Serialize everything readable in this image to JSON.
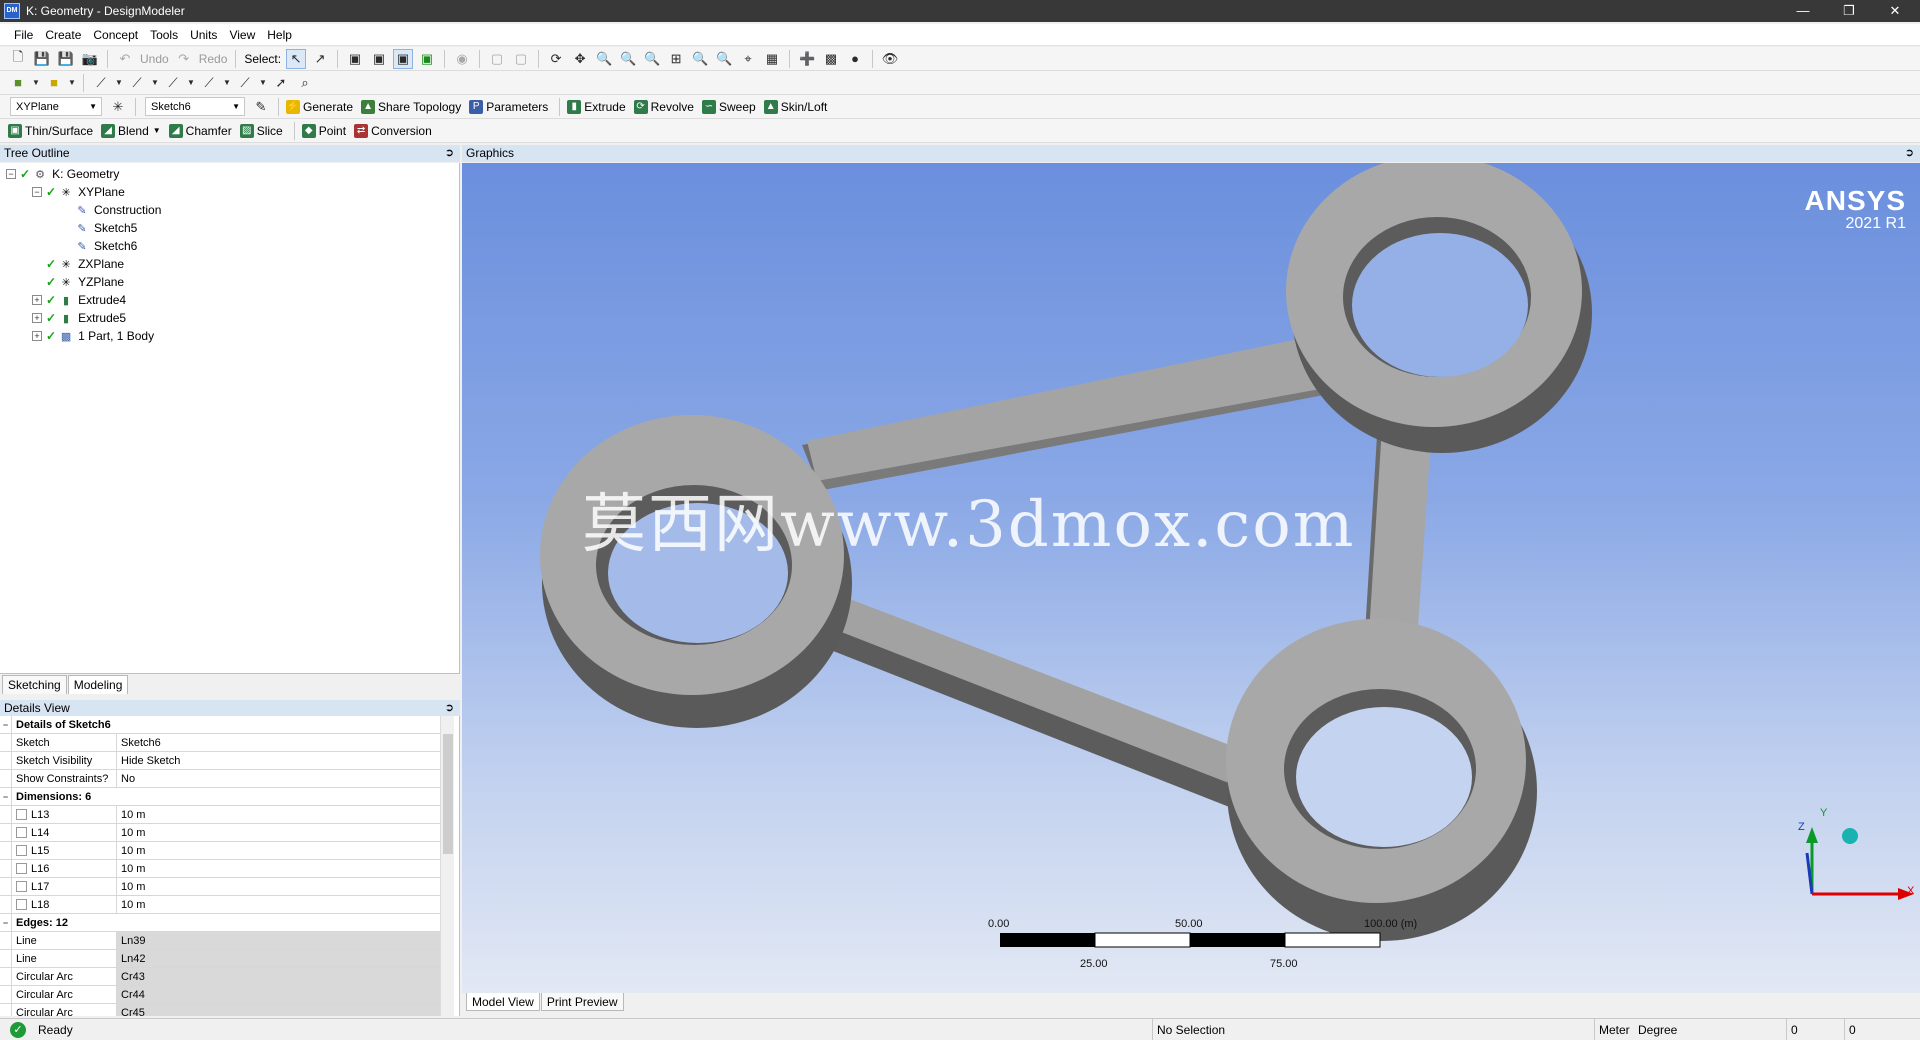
{
  "window": {
    "title": "K: Geometry - DesignModeler",
    "app_icon": "DM"
  },
  "menu": [
    "File",
    "Create",
    "Concept",
    "Tools",
    "Units",
    "View",
    "Help"
  ],
  "toolbar1": {
    "undo": "Undo",
    "redo": "Redo",
    "select": "Select:"
  },
  "toolbar3": {
    "plane": "XYPlane",
    "sketch": "Sketch6",
    "buttons": [
      "Generate",
      "Share Topology",
      "Parameters",
      "Extrude",
      "Revolve",
      "Sweep",
      "Skin/Loft"
    ]
  },
  "toolbar4": {
    "buttons": [
      "Thin/Surface",
      "Blend",
      "Chamfer",
      "Slice",
      "Point",
      "Conversion"
    ]
  },
  "tree": {
    "header": "Tree Outline",
    "items": [
      "K: Geometry",
      "XYPlane",
      "Construction",
      "Sketch5",
      "Sketch6",
      "ZXPlane",
      "YZPlane",
      "Extrude4",
      "Extrude5",
      "1 Part, 1 Body"
    ]
  },
  "panel_tabs": [
    "Sketching",
    "Modeling"
  ],
  "details": {
    "header": "Details View",
    "title": "Details of Sketch6",
    "rows": [
      {
        "k": "Sketch",
        "v": "Sketch6"
      },
      {
        "k": "Sketch Visibility",
        "v": "Hide Sketch"
      },
      {
        "k": "Show Constraints?",
        "v": "No"
      }
    ],
    "dimensions_title": "Dimensions: 6",
    "dimensions": [
      {
        "k": "L13",
        "v": "10 m"
      },
      {
        "k": "L14",
        "v": "10 m"
      },
      {
        "k": "L15",
        "v": "10 m"
      },
      {
        "k": "L16",
        "v": "10 m"
      },
      {
        "k": "L17",
        "v": "10 m"
      },
      {
        "k": "L18",
        "v": "10 m"
      }
    ],
    "edges_title": "Edges: 12",
    "edges": [
      {
        "k": "Line",
        "v": "Ln39"
      },
      {
        "k": "Line",
        "v": "Ln42"
      },
      {
        "k": "Circular Arc",
        "v": "Cr43"
      },
      {
        "k": "Circular Arc",
        "v": "Cr44"
      },
      {
        "k": "Circular Arc",
        "v": "Cr45"
      }
    ]
  },
  "graphics": {
    "header": "Graphics",
    "brand": "ANSYS",
    "version": "2021 R1",
    "watermark": "莫西网www.3dmox.com",
    "scale": {
      "top": [
        "0.00",
        "50.00",
        "100.00 (m)"
      ],
      "bottom": [
        "25.00",
        "75.00"
      ]
    },
    "axes": {
      "x": "X",
      "y": "Y",
      "z": "Z"
    },
    "tabs": [
      "Model View",
      "Print Preview"
    ]
  },
  "status": {
    "ready": "Ready",
    "selection": "No Selection",
    "unit": "Meter",
    "angle": "Degree",
    "v1": "0",
    "v2": "0"
  }
}
